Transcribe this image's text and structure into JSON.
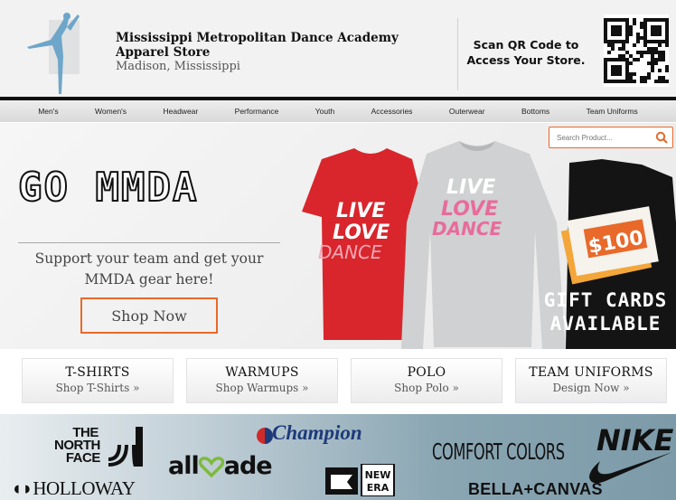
{
  "header": {
    "store_name": "Mississippi Metropolitan Dance Academy Apparel Store",
    "location": "Madison, Mississippi",
    "scan_text": "Scan QR Code to Access Your Store."
  },
  "nav": {
    "items": [
      "Men's",
      "Women's",
      "Headwear",
      "Performance",
      "Youth",
      "Accessories",
      "Outerwear",
      "Bottoms",
      "Team Uniforms"
    ]
  },
  "search": {
    "placeholder": "Search Product..."
  },
  "hero": {
    "title": "GO MMDA",
    "subtitle": "Support your team and get your MMDA gear here!",
    "cta_label": "Shop Now",
    "shirt_red_text": [
      "LIVE",
      "LOVE",
      "DANCE"
    ],
    "shirt_gray_text": [
      "LIVE",
      "LOVE",
      "DANCE"
    ],
    "gift_amount": "$100",
    "gift_text": [
      "GIFT CARDS",
      "AVAILABLE"
    ]
  },
  "categories": [
    {
      "title": "T-SHIRTS",
      "link": "Shop T-Shirts »"
    },
    {
      "title": "WARMUPS",
      "link": "Shop Warmups »"
    },
    {
      "title": "POLO",
      "link": "Shop Polo »"
    },
    {
      "title": "TEAM UNIFORMS",
      "link": "Design Now »"
    }
  ],
  "brands": {
    "north_face": [
      "THE",
      "NORTH",
      "FACE"
    ],
    "holloway": "HOLLOWAY",
    "champion": "Champion",
    "allmade_pre": "all",
    "allmade_post": "ade",
    "new_era": [
      "NEW",
      "ERA"
    ],
    "comfort_colors": "COMFORT COLORS",
    "nike": "NIKE",
    "bella": "BELLA+CANVAS"
  },
  "colors": {
    "accent": "#e8692a",
    "shirt_red": "#d8262c",
    "shirt_gray": "#cfd1d2",
    "champion_blue": "#1d3a7a",
    "champion_red": "#d12a2a",
    "allmade_green": "#7dba3c"
  }
}
